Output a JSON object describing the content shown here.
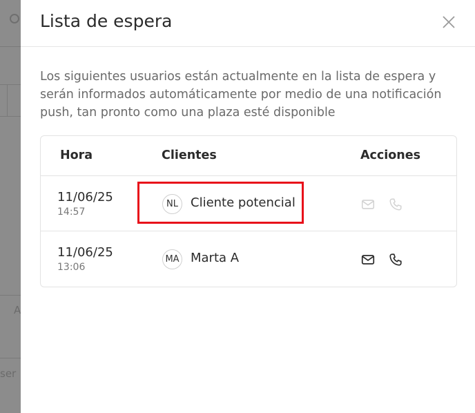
{
  "modal": {
    "title": "Lista de espera",
    "description": "Los siguientes usuarios están actualmente en la lista de espera y serán informados automáticamente por medio de una notificación push, tan pronto como una plaza esté disponible"
  },
  "table": {
    "headers": {
      "time": "Hora",
      "clients": "Clientes",
      "actions": "Acciones"
    },
    "rows": [
      {
        "date": "11/06/25",
        "time": "14:57",
        "initials": "NL",
        "name": "Cliente potencial",
        "actions_enabled": false,
        "highlighted": true
      },
      {
        "date": "11/06/25",
        "time": "13:06",
        "initials": "MA",
        "name": "Marta A",
        "actions_enabled": true,
        "highlighted": false
      }
    ]
  },
  "background": {
    "text_a": "A",
    "text_ser": "ser"
  },
  "colors": {
    "highlight": "#e8101a",
    "icon_active": "#2b2b2b",
    "icon_disabled": "#d2d2d2"
  }
}
